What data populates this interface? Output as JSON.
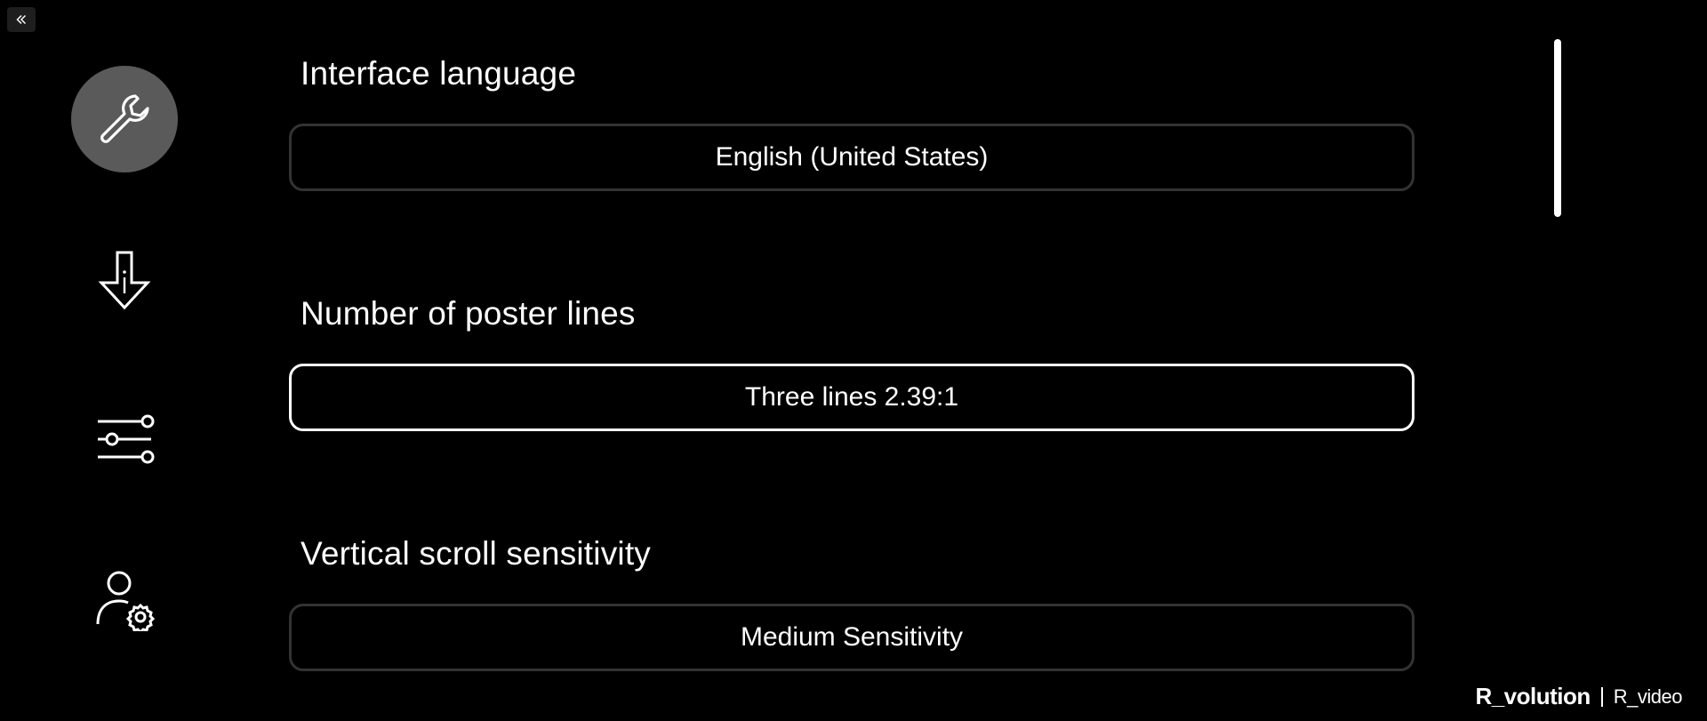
{
  "sidebar": {
    "collapse_icon": "double-chevron-left-icon",
    "items": [
      {
        "id": "general",
        "icon": "wrench-icon",
        "active": true
      },
      {
        "id": "downloads",
        "icon": "download-info-icon",
        "active": false
      },
      {
        "id": "preferences",
        "icon": "sliders-icon",
        "active": false
      },
      {
        "id": "account",
        "icon": "user-gear-icon",
        "active": false
      }
    ]
  },
  "settings": [
    {
      "title": "Interface language",
      "value": "English (United States)"
    },
    {
      "title": "Number of poster lines",
      "value": "Three lines 2.39:1"
    },
    {
      "title": "Vertical scroll sensitivity",
      "value": "Medium Sensitivity"
    }
  ],
  "brand": {
    "primary": "R_volution",
    "secondary": "R_video"
  },
  "colors": {
    "background": "#000000",
    "active_nav": "#5a5a5a",
    "box_border": "#333333",
    "focus_border": "#ffffff",
    "text": "#ffffff"
  }
}
